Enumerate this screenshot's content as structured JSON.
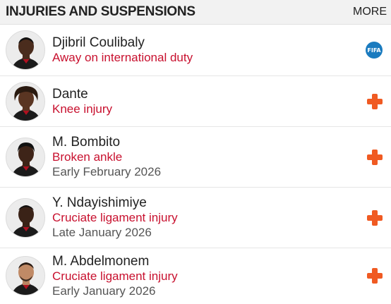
{
  "header": {
    "title": "INJURIES AND SUSPENSIONS",
    "more": "MORE"
  },
  "players": [
    {
      "name": "Djibril Coulibaly",
      "status": "Away on international duty",
      "return": "",
      "icon": "fifa-icon",
      "icon_text": "FIFA"
    },
    {
      "name": "Dante",
      "status": "Knee injury",
      "return": "",
      "icon": "injury-cross-icon"
    },
    {
      "name": "M. Bombito",
      "status": "Broken ankle",
      "return": "Early February 2026",
      "icon": "injury-cross-icon"
    },
    {
      "name": "Y. Ndayishimiye",
      "status": "Cruciate ligament injury",
      "return": "Late January 2026",
      "icon": "injury-cross-icon"
    },
    {
      "name": "M. Abdelmonem",
      "status": "Cruciate ligament injury",
      "return": "Early January 2026",
      "icon": "injury-cross-icon"
    }
  ],
  "colors": {
    "status": "#c8102e",
    "injury_icon": "#f05a22",
    "fifa_badge": "#1a7bbf"
  }
}
